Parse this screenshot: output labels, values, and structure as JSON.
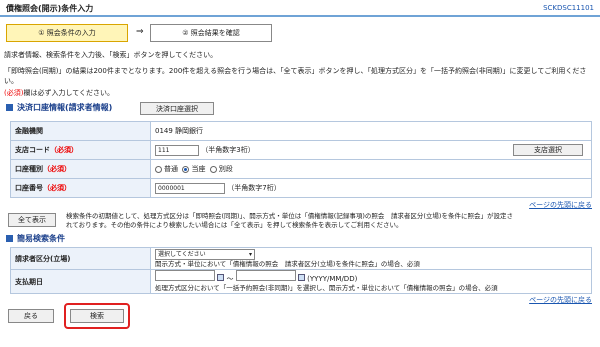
{
  "header": {
    "title": "債権照会(開示)条件入力",
    "screen_code": "SCKDSC11101"
  },
  "steps": [
    {
      "label": "① 照会条件の入力"
    },
    {
      "label": "② 照会結果を確認"
    }
  ],
  "step_arrow": "⇒",
  "instructions": {
    "line1": "請求者情報、検索条件を入力後、「検索」ボタンを押してください。",
    "line2": "「即時照会(同期)」の結果は200件までとなります。200件を超える照会を行う場合は、「全て表示」ボタンを押し、「処理方式区分」を「一括予約照会(非同期)」に変更してご利用ください。",
    "required_mark": "(必須)",
    "required_note": "欄は必ず入力してください。"
  },
  "section1": {
    "title": "決済口座情報(請求者情報)",
    "select_button": "決済口座選択",
    "rows": {
      "bank_label": "金融機関",
      "bank_value": "0149 静岡銀行",
      "branch_label": "支店コード",
      "branch_value": "111",
      "branch_hint": "（半角数字3桁）",
      "branch_button": "支店選択",
      "account_type_label": "口座種別",
      "account_type_options": [
        "普通",
        "当座",
        "別段"
      ],
      "account_type_selected": "当座",
      "account_no_label": "口座番号",
      "account_no_value": "0000001",
      "account_no_hint": "（半角数字7桁）"
    },
    "required": "（必須）",
    "page_top_link": "ページの先頭に戻る"
  },
  "show_all": {
    "button": "全て表示",
    "desc1": "検索条件の初期値として、処理方式区分は「即時照会(同期)」、開示方式・単位は「債権情報(記録事項)の照会　請求者区分(立場)を条件に照会」が設定さ",
    "desc2": "れております。その他の条件により検索したい場合には「全て表示」を押して検索条件を表示してご利用ください。"
  },
  "section2": {
    "title": "簡易検索条件",
    "requester_label": "請求者区分(立場)",
    "requester_select": "選択してください",
    "requester_note": "開示方式・単位において「債権情報の照会　請求者区分(立場)を条件に照会」の場合、必須",
    "date_label": "支払期日",
    "date_separator": "〜",
    "date_format": "(YYYY/MM/DD)",
    "date_note": "処理方式区分において「一括予約照会(非同期)」を選択し、開示方式・単位において「債権情報の照会」の場合、必須",
    "page_top_link": "ページの先頭に戻る"
  },
  "footer": {
    "back_button": "戻る",
    "search_button": "検索"
  },
  "colors": {
    "accent_blue": "#1a56b0",
    "required_red": "#e00000",
    "highlight_red": "#e02020",
    "step_active_bg": "#fff5b8"
  }
}
